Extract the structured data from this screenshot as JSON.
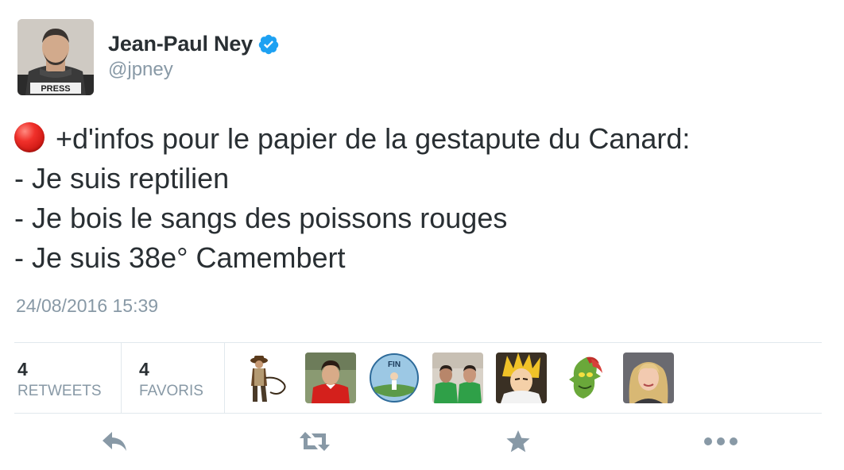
{
  "user": {
    "display_name": "Jean-Paul Ney",
    "handle": "@jpney",
    "verified": true,
    "avatar_text": "PRESS"
  },
  "tweet": {
    "emoji": "red-circle",
    "lines": [
      "+d'infos pour le papier de la gestapute du Canard:",
      "- Je suis reptilien",
      "- Je bois le sangs des poissons rouges",
      "- Je suis 38e° Camembert"
    ],
    "timestamp": "24/08/2016 15:39"
  },
  "stats": {
    "retweets": {
      "count": "4",
      "label": "RETWEETS"
    },
    "favorites": {
      "count": "4",
      "label": "FAVORIS"
    }
  },
  "favoriters": [
    {
      "name": "avatar-indiana-figure",
      "text": ""
    },
    {
      "name": "avatar-footballer-red",
      "text": ""
    },
    {
      "name": "avatar-fin-badge",
      "text": "FIN"
    },
    {
      "name": "avatar-two-men-green",
      "text": ""
    },
    {
      "name": "avatar-anime-blond",
      "text": ""
    },
    {
      "name": "avatar-green-creature",
      "text": ""
    },
    {
      "name": "avatar-blonde-woman",
      "text": ""
    }
  ],
  "actions": [
    "reply-icon",
    "retweet-icon",
    "favorite-icon",
    "more-icon"
  ],
  "colors": {
    "text": "#292f33",
    "muted": "#8899a6",
    "divider": "#e1e8ed",
    "verified": "#1da1f2",
    "action_icon": "#8899a6"
  }
}
